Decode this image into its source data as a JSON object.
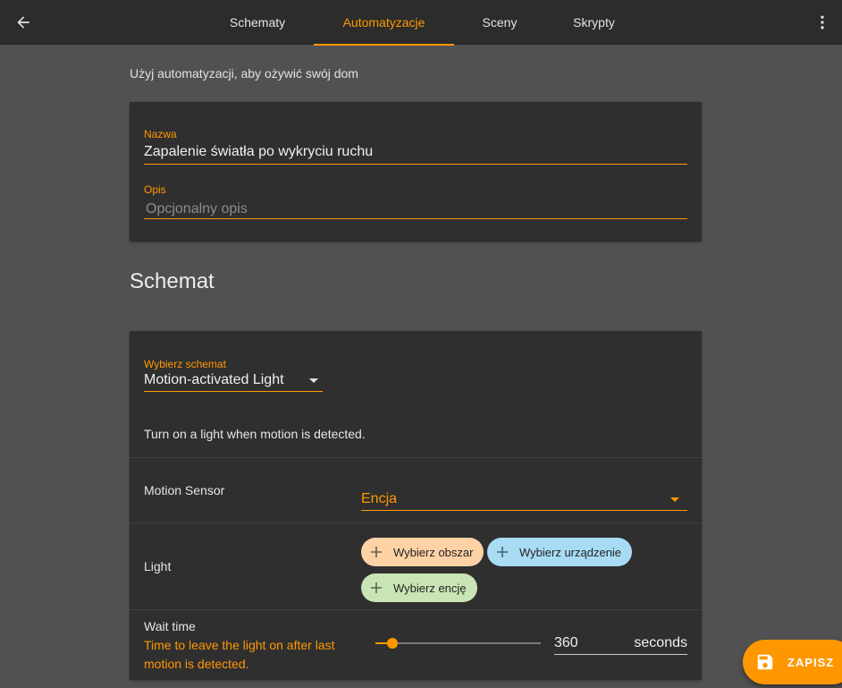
{
  "header": {
    "back_icon": "arrow-left-icon",
    "menu_icon": "dots-vertical-icon",
    "tabs": [
      {
        "label": "Schematy",
        "active": false
      },
      {
        "label": "Automatyzacje",
        "active": true
      },
      {
        "label": "Sceny",
        "active": false
      },
      {
        "label": "Skrypty",
        "active": false
      }
    ]
  },
  "intro_text": "Użyj automatyzacji, aby ożywić swój dom",
  "details": {
    "name_label": "Nazwa",
    "name_value": "Zapalenie światła po wykryciu ruchu",
    "description_label": "Opis",
    "description_placeholder": "Opcjonalny opis"
  },
  "blueprint_section": {
    "title": "Schemat",
    "select_label": "Wybierz schemat",
    "select_value": "Motion-activated Light",
    "description": "Turn on a light when motion is detected.",
    "inputs": {
      "motion_sensor": {
        "label": "Motion Sensor",
        "picker_value": "Encja"
      },
      "light": {
        "label": "Light",
        "chips": [
          {
            "label": "Wybierz obszar",
            "color": "#ffd2a6"
          },
          {
            "label": "Wybierz urządzenie",
            "color": "#a8dcf5"
          },
          {
            "label": "Wybierz encję",
            "color": "#c9e5b5"
          }
        ]
      },
      "wait_time": {
        "label": "Wait time",
        "description": "Time to leave the light on after last motion is detected.",
        "value": "360",
        "unit": "seconds",
        "slider_min": 0,
        "slider_max": 3600,
        "slider_value": 360
      }
    }
  },
  "save_button": {
    "label": "ZAPISZ",
    "icon": "floppy-disk-icon"
  },
  "colors": {
    "accent": "#ff9800",
    "background": "#515151",
    "card": "#2f2f2f",
    "topbar": "#2c2c2c"
  }
}
